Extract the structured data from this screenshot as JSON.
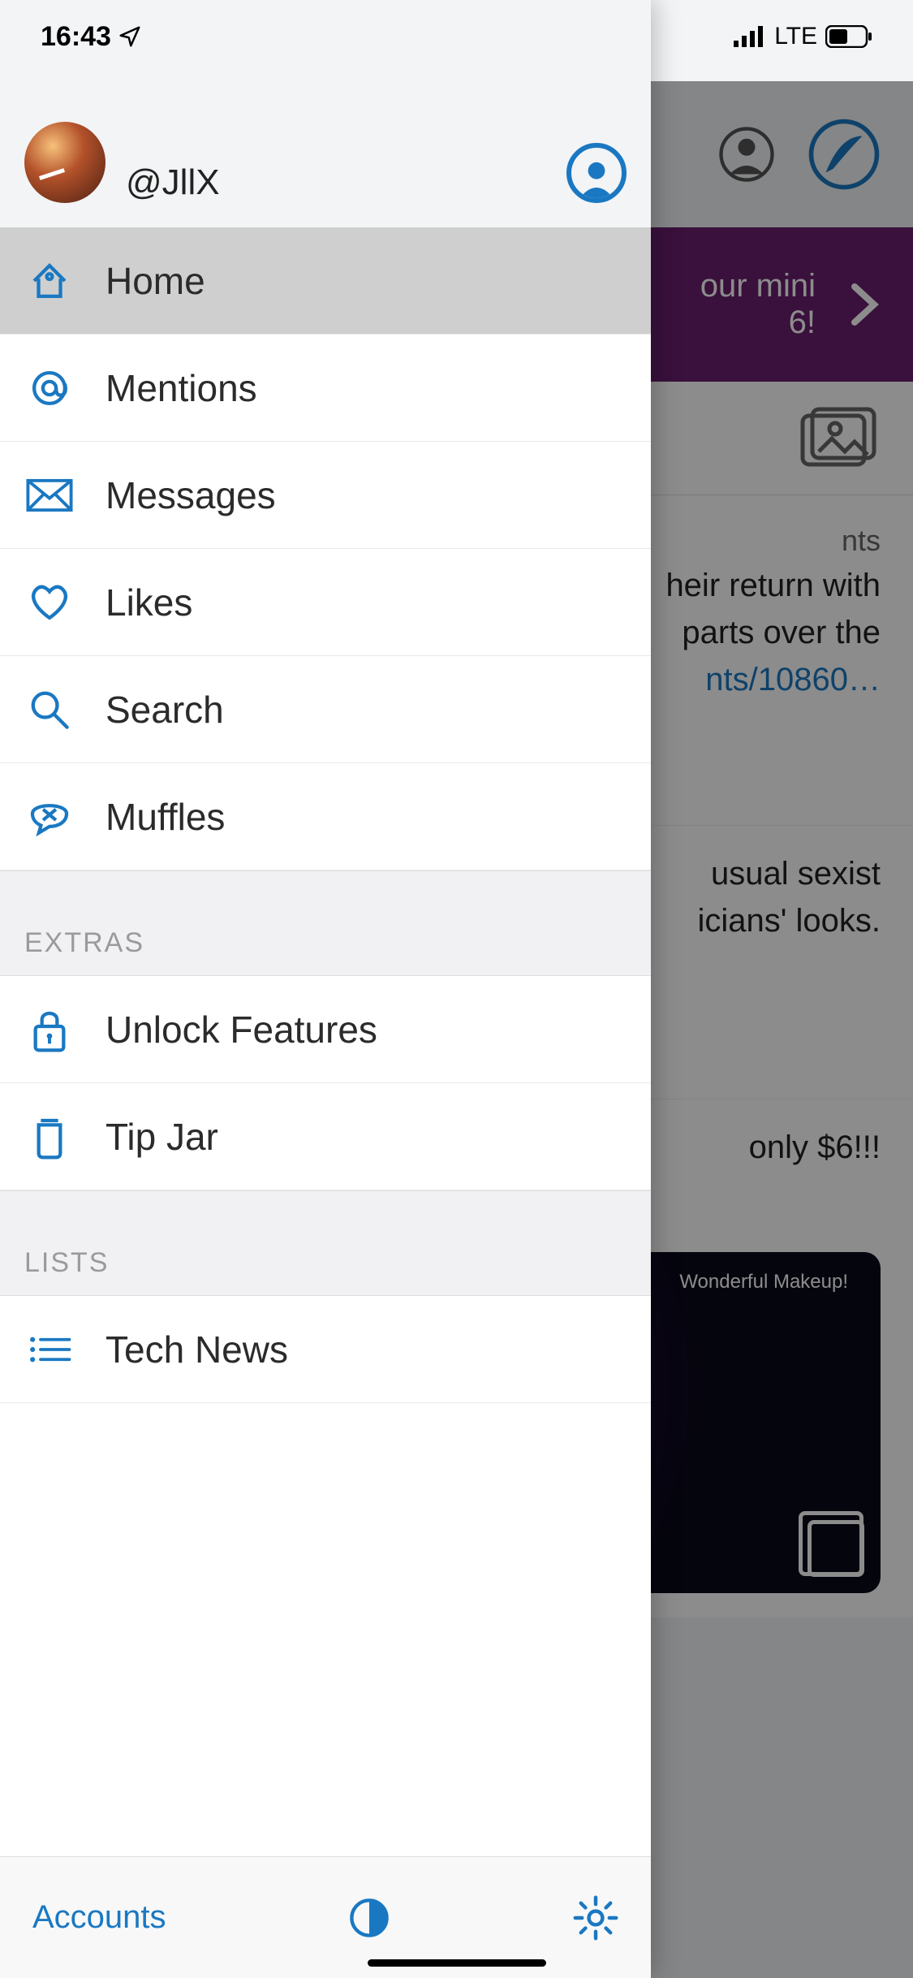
{
  "status": {
    "time": "16:43",
    "network_label": "LTE"
  },
  "drawer": {
    "handle": "@JllX",
    "menu": [
      {
        "label": "Home",
        "icon": "home-icon",
        "selected": true
      },
      {
        "label": "Mentions",
        "icon": "at-icon",
        "selected": false
      },
      {
        "label": "Messages",
        "icon": "envelope-icon",
        "selected": false
      },
      {
        "label": "Likes",
        "icon": "heart-icon",
        "selected": false
      },
      {
        "label": "Search",
        "icon": "search-icon",
        "selected": false
      },
      {
        "label": "Muffles",
        "icon": "muffle-icon",
        "selected": false
      }
    ],
    "sections": {
      "extras_header": "Extras",
      "extras": [
        {
          "label": "Unlock Features",
          "icon": "lock-icon"
        },
        {
          "label": "Tip Jar",
          "icon": "jar-icon"
        }
      ],
      "lists_header": "Lists",
      "lists": [
        {
          "label": "Tech News",
          "icon": "list-icon"
        }
      ]
    },
    "footer": {
      "accounts_label": "Accounts"
    }
  },
  "backdrop": {
    "banner_text_1": "our mini",
    "banner_text_2": "6!",
    "post1_meta": "nts",
    "post1_line1": "heir return with",
    "post1_line2": "parts over the",
    "post1_link": "nts/10860…",
    "post2_line1": " usual sexist",
    "post2_line2": "icians' looks.",
    "post3_line1": "only $6!!!",
    "image_caption": "Wonderful Makeup!"
  },
  "colors": {
    "accent": "#1a78c2",
    "banner": "#6a1e6e"
  }
}
